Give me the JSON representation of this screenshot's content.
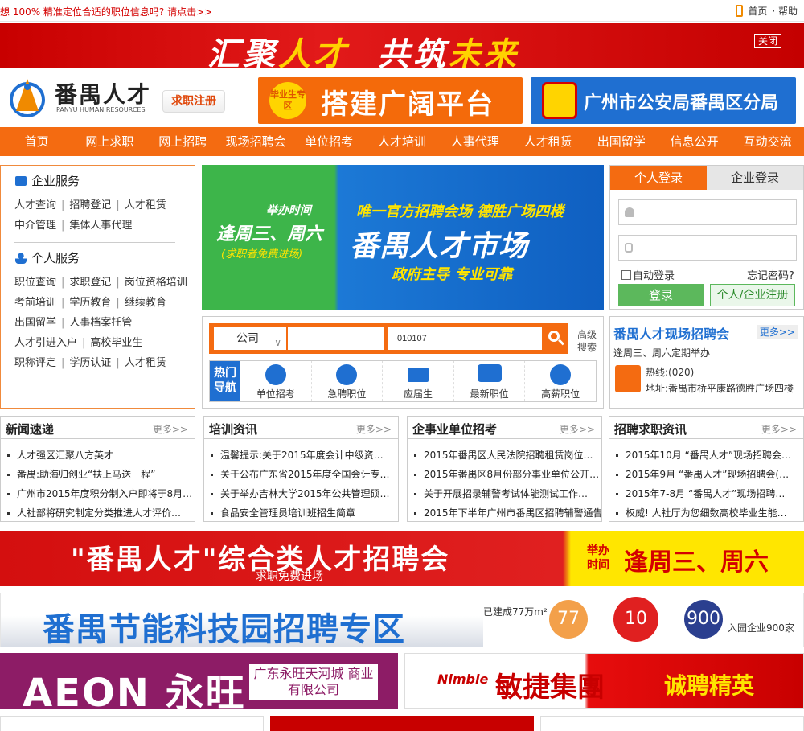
{
  "topbar": {
    "marquee": "想  100%  精准定位合适的职位信息吗? 请点击>>",
    "home": "首页",
    "help": "· 帮助"
  },
  "top_banner": {
    "part1": "汇聚",
    "part2": "人才",
    "part3": "共筑",
    "part4": "未来",
    "close": "关闭"
  },
  "header": {
    "logo_name": "番禺人才",
    "logo_en": "PANYU HUMAN RESOURCES",
    "register_btn": "求职注册",
    "ad1_tag": "毕业生专区",
    "ad1_text": "搭建广阔平台",
    "ad2_text": "广州市公安局番禺区分局"
  },
  "nav": [
    "首页",
    "网上求职",
    "网上招聘",
    "现场招聘会",
    "单位招考",
    "人才培训",
    "人事代理",
    "人才租赁",
    "出国留学",
    "信息公开",
    "互动交流"
  ],
  "services": {
    "corp_title": "企业服务",
    "corp_rows": [
      [
        "人才查询",
        "招聘登记",
        "人才租赁"
      ],
      [
        "中介管理",
        "集体人事代理"
      ]
    ],
    "personal_title": "个人服务",
    "personal_rows": [
      [
        "职位查询",
        "求职登记",
        "岗位资格培训"
      ],
      [
        "考前培训",
        "学历教育",
        "继续教育"
      ],
      [
        "出国留学",
        "人事档案托管"
      ],
      [
        "人才引进入户",
        "高校毕业生"
      ],
      [
        "职称评定",
        "学历认证",
        "人才租赁"
      ]
    ]
  },
  "promo": {
    "l1": "举办时间",
    "l2": "逢周三、周六",
    "l3": "(求职者免费进场)",
    "r1": "唯一官方招聘会场  德胜广场四楼",
    "r2": "番禺人才市场",
    "r3": "政府主导  专业可靠"
  },
  "login": {
    "tab_personal": "个人登录",
    "tab_company": "企业登录",
    "auto": "自动登录",
    "forgot": "忘记密码?",
    "login_btn": "登录",
    "register": "个人/企业注册"
  },
  "search": {
    "select_value": "公司",
    "keyword_value": "010107",
    "advanced": "高级搜索",
    "hot_label": "热门导航",
    "hot_items": [
      "单位招考",
      "急聘职位",
      "应届生",
      "最新职位",
      "高薪职位"
    ]
  },
  "fair": {
    "title": "番禺人才现场招聘会",
    "more": "更多>>",
    "sub": "逢周三、周六定期举办",
    "phone": "热线:(020)",
    "addr": "地址:番禺市桥平康路德胜广场四楼"
  },
  "news": [
    {
      "title": "新闻速递",
      "more": "更多>>",
      "items": [
        "人才强区汇聚八方英才",
        "番禺:助海归创业“扶上马送一程”",
        "广州市2015年度积分制入户即将于8月…",
        "人社部将研究制定分类推进人才评价…"
      ]
    },
    {
      "title": "培训资讯",
      "more": "更多>>",
      "items": [
        "温馨提示:关于2015年度会计中级资…",
        "关于公布广东省2015年度全国会计专…",
        "关于举办吉林大学2015年公共管理硕…",
        "食品安全管理员培训班招生简章"
      ]
    },
    {
      "title": "企事业单位招考",
      "more": "更多>>",
      "items": [
        "2015年番禺区人民法院招聘租赁岗位…",
        "2015年番禺区8月份部分事业单位公开…",
        "关于开展招录辅警考试体能测试工作…",
        "2015年下半年广州市番禺区招聘辅警通告"
      ]
    },
    {
      "title": "招聘求职资讯",
      "more": "更多>>",
      "items": [
        "2015年10月 “番禺人才”现场招聘会…",
        "2015年9月 “番禺人才”现场招聘会(…",
        "2015年7-8月 “番禺人才”现场招聘…",
        "权威! 人社厅为您细数高校毕业生能…"
      ]
    }
  ],
  "ad_fair": {
    "title": "\"番禺人才\"综合类人才招聘会",
    "sub": "求职免费进场",
    "when_label": "举办时间",
    "when": "逢周三、周六"
  },
  "ad_park": {
    "title": "番禺节能科技园招聘专区",
    "built": "已建成77万m²",
    "n1": "77",
    "n2": "10",
    "n3": "900",
    "enterprises": "入园企业900家"
  },
  "ad_aeon": {
    "brand": "AEON 永旺",
    "company": "广东永旺天河城 商业有限公司"
  },
  "ad_nimble": {
    "logo": "Nimble",
    "name": "敏捷集團",
    "slogan": "诚聘精英"
  },
  "colors": {
    "accent": "#f46b11",
    "blue": "#1f6fd1",
    "red": "#d40000"
  }
}
